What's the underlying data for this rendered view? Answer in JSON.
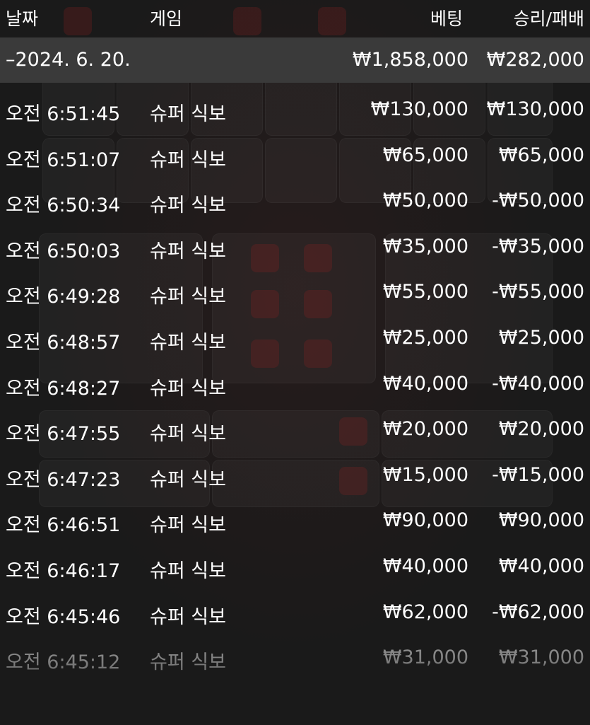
{
  "header": {
    "date": "날짜",
    "game": "게임",
    "bet": "베팅",
    "result": "승리/패배"
  },
  "summary": {
    "date": "–2024. 6. 20.",
    "total_bet": "₩1,858,000",
    "total_result": "₩282,000"
  },
  "rows": [
    {
      "time": "오전 6:51:45",
      "game": "슈퍼 식보",
      "bet": "₩130,000",
      "result": "₩130,000"
    },
    {
      "time": "오전 6:51:07",
      "game": "슈퍼 식보",
      "bet": "₩65,000",
      "result": "₩65,000"
    },
    {
      "time": "오전 6:50:34",
      "game": "슈퍼 식보",
      "bet": "₩50,000",
      "result": "-₩50,000"
    },
    {
      "time": "오전 6:50:03",
      "game": "슈퍼 식보",
      "bet": "₩35,000",
      "result": "-₩35,000"
    },
    {
      "time": "오전 6:49:28",
      "game": "슈퍼 식보",
      "bet": "₩55,000",
      "result": "-₩55,000"
    },
    {
      "time": "오전 6:48:57",
      "game": "슈퍼 식보",
      "bet": "₩25,000",
      "result": "₩25,000"
    },
    {
      "time": "오전 6:48:27",
      "game": "슈퍼 식보",
      "bet": "₩40,000",
      "result": "-₩40,000"
    },
    {
      "time": "오전 6:47:55",
      "game": "슈퍼 식보",
      "bet": "₩20,000",
      "result": "₩20,000"
    },
    {
      "time": "오전 6:47:23",
      "game": "슈퍼 식보",
      "bet": "₩15,000",
      "result": "-₩15,000"
    },
    {
      "time": "오전 6:46:51",
      "game": "슈퍼 식보",
      "bet": "₩90,000",
      "result": "₩90,000"
    },
    {
      "time": "오전 6:46:17",
      "game": "슈퍼 식보",
      "bet": "₩40,000",
      "result": "₩40,000"
    },
    {
      "time": "오전 6:45:46",
      "game": "슈퍼 식보",
      "bet": "₩62,000",
      "result": "-₩62,000"
    },
    {
      "time": "오전 6:45:12",
      "game": "슈퍼 식보",
      "bet": "₩31,000",
      "result": "₩31,000"
    }
  ]
}
